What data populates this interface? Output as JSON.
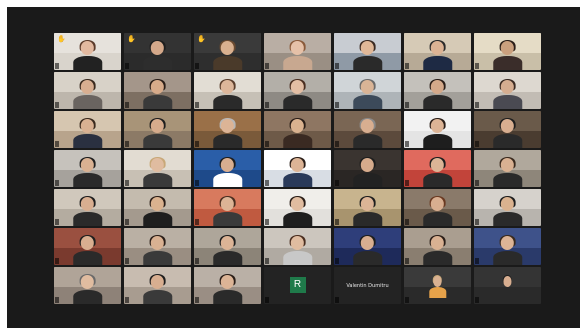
{
  "meeting": {
    "accent": "#f4c430",
    "avatar_color": "#1f7a4a",
    "tiles": [
      {
        "label": "",
        "hand": true,
        "bg": "#d9d4cc",
        "wall": "#e6e2dc",
        "skin": "#e2b9a0",
        "hair": "#5a3a2a",
        "shirt": "#222"
      },
      {
        "label": "",
        "hand": true,
        "bg": "#2b2b2b",
        "wall": "#333",
        "skin": "#d4a88a",
        "hair": "#1e1e1e",
        "shirt": "#2d2d2d"
      },
      {
        "label": "",
        "hand": true,
        "bg": "#2e2e2e",
        "wall": "#3a3a3a",
        "skin": "#d9b08f",
        "hair": "#6a4a30",
        "shirt": "#4a3a2a"
      },
      {
        "label": "",
        "hand": false,
        "bg": "#9a8f84",
        "wall": "#b9aea4",
        "skin": "#e6c1a8",
        "hair": "#8a5a3a",
        "shirt": "#c8a890"
      },
      {
        "label": "",
        "hand": false,
        "bg": "#8f9aa6",
        "wall": "#c8ccd2",
        "skin": "#e0b898",
        "hair": "#3a2a22",
        "shirt": "#2a2a2a"
      },
      {
        "label": "",
        "hand": false,
        "bg": "#b7aa96",
        "wall": "#d6cab6",
        "skin": "#dcb394",
        "hair": "#2a2a2a",
        "shirt": "#1e2a44"
      },
      {
        "label": "",
        "hand": false,
        "bg": "#c9bfa8",
        "wall": "#e5dcc6",
        "skin": "#caa07e",
        "hair": "#2a1e18",
        "shirt": "#3a2d2a"
      },
      {
        "label": "",
        "hand": false,
        "bg": "#bdb6ac",
        "wall": "#d8d2c8",
        "skin": "#d8ae90",
        "hair": "#3a2a1e",
        "shirt": "#6a6460"
      },
      {
        "label": "",
        "hand": false,
        "bg": "#7d6f62",
        "wall": "#a4968a",
        "skin": "#d7ab8a",
        "hair": "#2a1e18",
        "shirt": "#3a3a3a"
      },
      {
        "label": "",
        "hand": false,
        "bg": "#c6c0b6",
        "wall": "#e2ddd4",
        "skin": "#dcb69a",
        "hair": "#5a3e2c",
        "shirt": "#2a2a2a"
      },
      {
        "label": "",
        "hand": false,
        "bg": "#8e8a84",
        "wall": "#b3afa8",
        "skin": "#e3bea4",
        "hair": "#4a2e20",
        "shirt": "#2a2a2a"
      },
      {
        "label": "",
        "hand": false,
        "bg": "#aeb4b8",
        "wall": "#d0d5d8",
        "skin": "#d9b496",
        "hair": "#6a6a6a",
        "shirt": "#3c4a5a"
      },
      {
        "label": "",
        "hand": false,
        "bg": "#a3a09a",
        "wall": "#c4c1bb",
        "skin": "#d4a98a",
        "hair": "#2a1e18",
        "shirt": "#2a2a2a"
      },
      {
        "label": "",
        "hand": false,
        "bg": "#c2bcb4",
        "wall": "#ddd8d0",
        "skin": "#d5ad90",
        "hair": "#3a2a22",
        "shirt": "#4a4a52"
      },
      {
        "label": "",
        "hand": false,
        "bg": "#b8a48c",
        "wall": "#d6c6b0",
        "skin": "#d9b192",
        "hair": "#3a2a1e",
        "shirt": "#2a3040"
      },
      {
        "label": "",
        "hand": false,
        "bg": "#8c7a66",
        "wall": "#a89478",
        "skin": "#d6ab8c",
        "hair": "#1e1e1e",
        "shirt": "#3a3a3a"
      },
      {
        "label": "",
        "hand": false,
        "bg": "#7a5a3a",
        "wall": "#9a7048",
        "skin": "#dcb496",
        "hair": "#b8b8b8",
        "shirt": "#2a2a2a"
      },
      {
        "label": "",
        "hand": false,
        "bg": "#6e5a48",
        "wall": "#8e7662",
        "skin": "#dab28f",
        "hair": "#2a1e18",
        "shirt": "#3a2a22"
      },
      {
        "label": "",
        "hand": false,
        "bg": "#5c4a3c",
        "wall": "#7a6654",
        "skin": "#d8ae90",
        "hair": "#8a8a8a",
        "shirt": "#2a2a2a"
      },
      {
        "label": "",
        "hand": false,
        "bg": "#e4e4e4",
        "wall": "#f2f2f2",
        "skin": "#dcb496",
        "hair": "#2a1e18",
        "shirt": "#1e1e1e"
      },
      {
        "label": "",
        "hand": false,
        "bg": "#4a3c30",
        "wall": "#6a5a4a",
        "skin": "#d8ae90",
        "hair": "#1e1e1e",
        "shirt": "#2a2a2a"
      },
      {
        "label": "",
        "hand": false,
        "bg": "#a6a29c",
        "wall": "#c6c2bc",
        "skin": "#d9b192",
        "hair": "#1e1e1e",
        "shirt": "#2a2a2a"
      },
      {
        "label": "",
        "hand": false,
        "bg": "#c8c0b4",
        "wall": "#e2dcd2",
        "skin": "#e0bca0",
        "hair": "#c8a878",
        "shirt": "#3a3a3a"
      },
      {
        "label": "",
        "hand": false,
        "bg": "#1e4a8a",
        "wall": "#2a5ea8",
        "skin": "#d8ae90",
        "hair": "#1e1e1e",
        "shirt": "#ffffff"
      },
      {
        "label": "",
        "hand": false,
        "bg": "#d8dde4",
        "wall": "#ffffff",
        "skin": "#dcb496",
        "hair": "#2a1e18",
        "shirt": "#2a3a5a"
      },
      {
        "label": "",
        "hand": false,
        "bg": "#2a2624",
        "wall": "#3a3430",
        "skin": "#d6ab8c",
        "hair": "#1e1e1e",
        "shirt": "#222"
      },
      {
        "label": "",
        "hand": false,
        "bg": "#c2443a",
        "wall": "#e06a5e",
        "skin": "#dcb496",
        "hair": "#1e1e1e",
        "shirt": "#2a2a2a"
      },
      {
        "label": "",
        "hand": false,
        "bg": "#8e867a",
        "wall": "#b0a89c",
        "skin": "#d9b192",
        "hair": "#3a2a1e",
        "shirt": "#2a2a2a"
      },
      {
        "label": "",
        "hand": false,
        "bg": "#b4aca0",
        "wall": "#d0c8bc",
        "skin": "#d8ae90",
        "hair": "#1e1e1e",
        "shirt": "#2a2a2a"
      },
      {
        "label": "",
        "hand": false,
        "bg": "#a49a8e",
        "wall": "#c4bbae",
        "skin": "#dab28f",
        "hair": "#2a1e18",
        "shirt": "#1e1e1e"
      },
      {
        "label": "",
        "hand": false,
        "bg": "#c05a40",
        "wall": "#d87a5e",
        "skin": "#dcb496",
        "hair": "#4a2e20",
        "shirt": "#3a3a3a"
      },
      {
        "label": "",
        "hand": false,
        "bg": "#e2e0dc",
        "wall": "#f0eeea",
        "skin": "#e0bca0",
        "hair": "#2a1e18",
        "shirt": "#1e1e1e"
      },
      {
        "label": "",
        "hand": false,
        "bg": "#a8946e",
        "wall": "#c8b48e",
        "skin": "#dcb496",
        "hair": "#1e1e1e",
        "shirt": "#2a2a2a"
      },
      {
        "label": "",
        "hand": false,
        "bg": "#6a5a4a",
        "wall": "#8a7a6a",
        "skin": "#d8ae90",
        "hair": "#6a3a22",
        "shirt": "#2a2a2a"
      },
      {
        "label": "",
        "hand": false,
        "bg": "#b8b4ae",
        "wall": "#d6d2cc",
        "skin": "#dab28f",
        "hair": "#1e1e1e",
        "shirt": "#2a2a2a"
      },
      {
        "label": "",
        "hand": false,
        "bg": "#7a3a2e",
        "wall": "#9a5040",
        "skin": "#d8ae90",
        "hair": "#1e1e1e",
        "shirt": "#2a2a2a"
      },
      {
        "label": "",
        "hand": false,
        "bg": "#9a8e82",
        "wall": "#bab0a4",
        "skin": "#d9b192",
        "hair": "#2a1e18",
        "shirt": "#3a3a3a"
      },
      {
        "label": "",
        "hand": false,
        "bg": "#8c8478",
        "wall": "#aea69a",
        "skin": "#dcb496",
        "hair": "#1e1e1e",
        "shirt": "#2a2a2a"
      },
      {
        "label": "",
        "hand": false,
        "bg": "#b0aaa2",
        "wall": "#ccc6be",
        "skin": "#e0bca0",
        "hair": "#4a2e20",
        "shirt": "#c8c8c8"
      },
      {
        "label": "",
        "hand": false,
        "bg": "#1e2a5a",
        "wall": "#2e3e7a",
        "skin": "#d8ae90",
        "hair": "#1e1e1e",
        "shirt": "#2a2a2a"
      },
      {
        "label": "",
        "hand": false,
        "bg": "#8a7e70",
        "wall": "#aa9e90",
        "skin": "#d9b192",
        "hair": "#2a1e18",
        "shirt": "#2a2a2a"
      },
      {
        "label": "",
        "hand": false,
        "bg": "#2a3a6a",
        "wall": "#3e528a",
        "skin": "#dcb496",
        "hair": "#3a2a1e",
        "shirt": "#2a2a2a"
      },
      {
        "label": "",
        "hand": false,
        "bg": "#8e8278",
        "wall": "#b0a498",
        "skin": "#e0bca0",
        "hair": "#6a6a6a",
        "shirt": "#2a2a2a"
      },
      {
        "label": "",
        "hand": false,
        "bg": "#a89c90",
        "wall": "#c8bcb0",
        "skin": "#d8ae90",
        "hair": "#1e1e1e",
        "shirt": "#3a3a3a"
      },
      {
        "label": "",
        "hand": false,
        "bg": "#9a8e84",
        "wall": "#bab0a6",
        "skin": "#dcb496",
        "hair": "#2a1e18",
        "shirt": "#2a2a2a"
      },
      {
        "label": "",
        "hand": false,
        "avatar": true,
        "initial": "R"
      },
      {
        "label": "",
        "hand": false,
        "avatar": true,
        "name": "Valentin Dumitru"
      },
      {
        "label": "",
        "hand": false,
        "bg": "#2a2a2a",
        "wall": "#3a3a3a",
        "skin": "#d9b192",
        "hair": "#c8a878",
        "shirt": "#e6a24a",
        "small": true
      },
      {
        "label": "",
        "hand": false,
        "bg": "#2a2a2a",
        "wall": "#343434",
        "skin": "#d8ae90",
        "hair": "#1e1e1e",
        "shirt": "#2a2a2a",
        "small": true
      }
    ]
  }
}
